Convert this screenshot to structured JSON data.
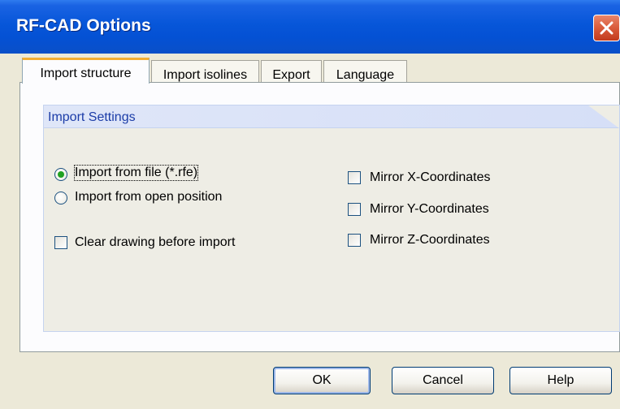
{
  "window": {
    "title": "RF-CAD Options"
  },
  "tabs": [
    {
      "label": "Import structure",
      "active": true
    },
    {
      "label": "Import isolines",
      "active": false
    },
    {
      "label": "Export",
      "active": false
    },
    {
      "label": "Language",
      "active": false
    }
  ],
  "group": {
    "title": "Import Settings"
  },
  "import_source": {
    "options": [
      {
        "label": "Import from file (*.rfe)",
        "selected": true
      },
      {
        "label": "Import from open position",
        "selected": false
      }
    ]
  },
  "clear_drawing": {
    "label": "Clear drawing before import",
    "checked": false
  },
  "mirror": [
    {
      "label": "Mirror X-Coordinates",
      "checked": false
    },
    {
      "label": "Mirror Y-Coordinates",
      "checked": false
    },
    {
      "label": "Mirror Z-Coordinates",
      "checked": false
    }
  ],
  "buttons": {
    "ok": "OK",
    "cancel": "Cancel",
    "help": "Help"
  },
  "colors": {
    "title_bar": "#0451d4",
    "close_button": "#d95b3b",
    "active_tab_accent": "#f2ae33",
    "group_header_text": "#1c3da8"
  }
}
